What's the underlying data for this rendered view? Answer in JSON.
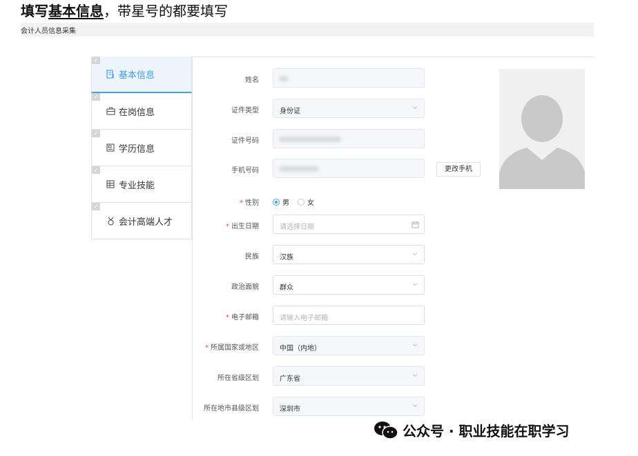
{
  "headline": {
    "bold_part": "填写",
    "underlined_part": "基本信息",
    "rest": "，带星号的都要填写"
  },
  "subbar": {
    "title": "会计人员信息采集"
  },
  "sidebar": {
    "items": [
      {
        "label": "基本信息",
        "icon": "document-icon",
        "active": true
      },
      {
        "label": "在岗信息",
        "icon": "briefcase-icon",
        "active": false
      },
      {
        "label": "学历信息",
        "icon": "picture-icon",
        "active": false
      },
      {
        "label": "专业技能",
        "icon": "grid-icon",
        "active": false
      },
      {
        "label": "会计高端人才",
        "icon": "medal-icon",
        "active": false
      }
    ],
    "check_mark": "✓"
  },
  "form": {
    "name": {
      "label": "姓名",
      "value": ""
    },
    "id_type": {
      "label": "证件类型",
      "value": "身份证"
    },
    "id_number": {
      "label": "证件号码",
      "value": ""
    },
    "phone": {
      "label": "手机号码",
      "value": "",
      "button": "更改手机"
    },
    "gender": {
      "label": "性别",
      "required": "*",
      "options": [
        "男",
        "女"
      ],
      "selected": "男"
    },
    "birth_date": {
      "label": "出生日期",
      "required": "*",
      "placeholder": "请选择日期"
    },
    "ethnicity": {
      "label": "民族",
      "value": "汉族"
    },
    "political_status": {
      "label": "政治面貌",
      "value": "群众"
    },
    "email": {
      "label": "电子邮箱",
      "required": "*",
      "placeholder": "请输入电子邮箱"
    },
    "country": {
      "label": "所属国家或地区",
      "required": "*",
      "value": "中国（内地）"
    },
    "province": {
      "label": "所在省级区划",
      "value": "广东省"
    },
    "city": {
      "label": "所在地市县级区划",
      "value": "深圳市"
    }
  },
  "footer": {
    "text": "公众号 · 职业技能在职学习"
  },
  "colors": {
    "accent": "#409eff",
    "required": "#e34b4b",
    "active_bg": "#eef4fb"
  }
}
